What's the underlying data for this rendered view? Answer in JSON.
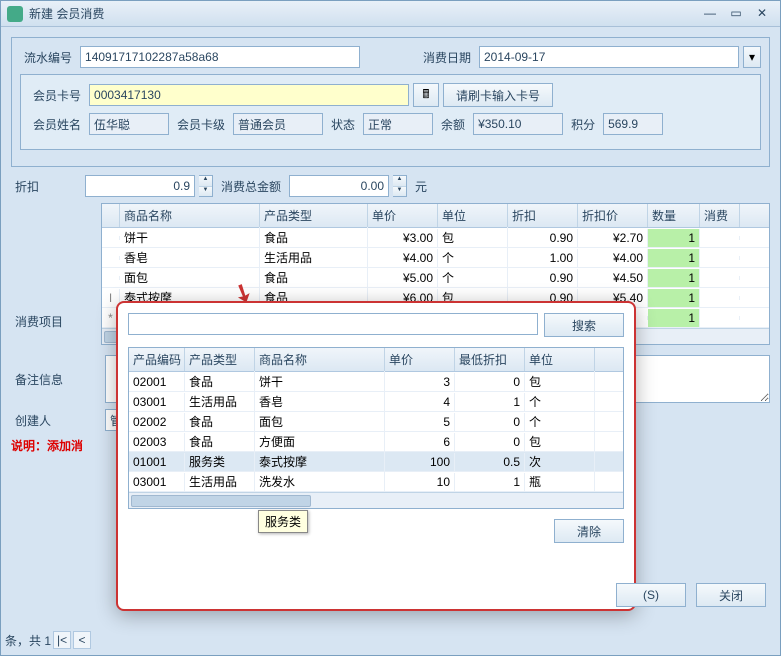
{
  "window": {
    "title": "新建 会员消费"
  },
  "header": {
    "serial_label": "流水编号",
    "serial_value": "14091717102287a58a68",
    "date_label": "消费日期",
    "date_value": "2014-09-17"
  },
  "card": {
    "card_label": "会员卡号",
    "card_value": "0003417130",
    "swipe_hint": "请刷卡输入卡号",
    "name_label": "会员姓名",
    "name_value": "伍华聪",
    "level_label": "会员卡级",
    "level_value": "普通会员",
    "status_label": "状态",
    "status_value": "正常",
    "balance_label": "余额",
    "balance_value": "¥350.10",
    "points_label": "积分",
    "points_value": "569.9"
  },
  "discount": {
    "label": "折扣",
    "value": "0.9",
    "total_label": "消费总金额",
    "total_value": "0.00",
    "unit": "元"
  },
  "items_section_label": "消费项目",
  "main_table": {
    "headers": [
      "商品名称",
      "产品类型",
      "单价",
      "单位",
      "折扣",
      "折扣价",
      "数量",
      "消费"
    ],
    "rows": [
      {
        "indicator": "",
        "name": "饼干",
        "type": "食品",
        "price": "¥3.00",
        "unit": "包",
        "discount": "0.90",
        "dprice": "¥2.70",
        "qty": "1"
      },
      {
        "indicator": "",
        "name": "香皂",
        "type": "生活用品",
        "price": "¥4.00",
        "unit": "个",
        "discount": "1.00",
        "dprice": "¥4.00",
        "qty": "1"
      },
      {
        "indicator": "",
        "name": "面包",
        "type": "食品",
        "price": "¥5.00",
        "unit": "个",
        "discount": "0.90",
        "dprice": "¥4.50",
        "qty": "1"
      },
      {
        "indicator": "I",
        "name": "泰式按摩",
        "type": "食品",
        "price": "¥6.00",
        "unit": "包",
        "discount": "0.90",
        "dprice": "¥5.40",
        "qty": "1"
      },
      {
        "indicator": "*",
        "name": "",
        "type": "",
        "price": "",
        "unit": "",
        "discount": "",
        "dprice": "",
        "qty": "1"
      }
    ]
  },
  "remark_label": "备注信息",
  "creator_label": "创建人",
  "creator_value": "管",
  "note_prefix": "说明：",
  "note_text": "添加消",
  "popup": {
    "search_btn": "搜索",
    "clear_btn": "清除",
    "headers": [
      "产品编码",
      "产品类型",
      "商品名称",
      "单价",
      "最低折扣",
      "单位"
    ],
    "rows": [
      {
        "code": "02001",
        "type": "食品",
        "name": "饼干",
        "price": "3",
        "min": "0",
        "unit": "包"
      },
      {
        "code": "03001",
        "type": "生活用品",
        "name": "香皂",
        "price": "4",
        "min": "1",
        "unit": "个"
      },
      {
        "code": "02002",
        "type": "食品",
        "name": "面包",
        "price": "5",
        "min": "0",
        "unit": "个"
      },
      {
        "code": "02003",
        "type": "食品",
        "name": "方便面",
        "price": "6",
        "min": "0",
        "unit": "包"
      },
      {
        "code": "01001",
        "type": "服务类",
        "name": "泰式按摩",
        "price": "100",
        "min": "0.5",
        "unit": "次"
      },
      {
        "code": "03001",
        "type": "生活用品",
        "name": "洗发水",
        "price": "10",
        "min": "1",
        "unit": "瓶"
      }
    ],
    "tooltip": "服务类"
  },
  "footer": {
    "btn_s": "(S)",
    "btn_close": "关闭"
  },
  "pager": {
    "text": "条，共 1"
  }
}
